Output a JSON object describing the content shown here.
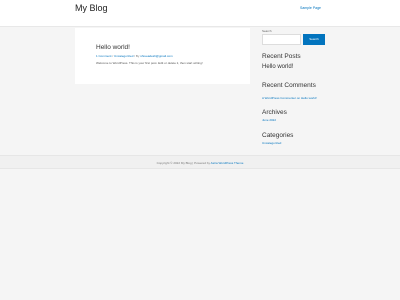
{
  "header": {
    "site_title": "My Blog",
    "nav_link": "Sample Page"
  },
  "post": {
    "title": "Hello world!",
    "meta_comments": "1 Comment",
    "meta_sep1": " / ",
    "meta_category": "Uncategorized",
    "meta_sep2": " / By ",
    "meta_author": "shreeadesh@gmail.com",
    "excerpt": "Welcome to WordPress. This is your first post. Edit or delete it, then start writing!"
  },
  "sidebar": {
    "search_label": "Search",
    "search_button": "Search",
    "recent_posts_title": "Recent Posts",
    "recent_posts": [
      "Hello world!"
    ],
    "recent_comments_title": "Recent Comments",
    "recent_comments": [
      "A WordPress Commenter on Hello world!"
    ],
    "archives_title": "Archives",
    "archives": [
      "June 2022"
    ],
    "categories_title": "Categories",
    "categories": [
      "Uncategorized"
    ]
  },
  "footer": {
    "text_prefix": "Copyright © 2022 My Blog | Powered by ",
    "link": "Astra WordPress Theme"
  }
}
